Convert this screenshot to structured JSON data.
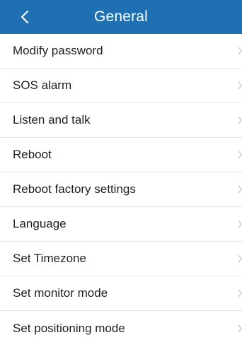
{
  "colors": {
    "header_bg": "#1f6fb3",
    "header_text": "#ffffff",
    "item_text": "#1f1f1f",
    "divider": "#e4e4e4",
    "chevron": "#c4c4c4"
  },
  "header": {
    "title": "General",
    "back_icon": "chevron-left-icon"
  },
  "menu": {
    "chevron_icon": "chevron-right-icon",
    "items": [
      {
        "label": "Modify password"
      },
      {
        "label": "SOS alarm"
      },
      {
        "label": "Listen and talk"
      },
      {
        "label": "Reboot"
      },
      {
        "label": "Reboot factory settings"
      },
      {
        "label": "Language"
      },
      {
        "label": "Set Timezone"
      },
      {
        "label": "Set monitor mode"
      },
      {
        "label": "Set positioning mode"
      }
    ]
  }
}
